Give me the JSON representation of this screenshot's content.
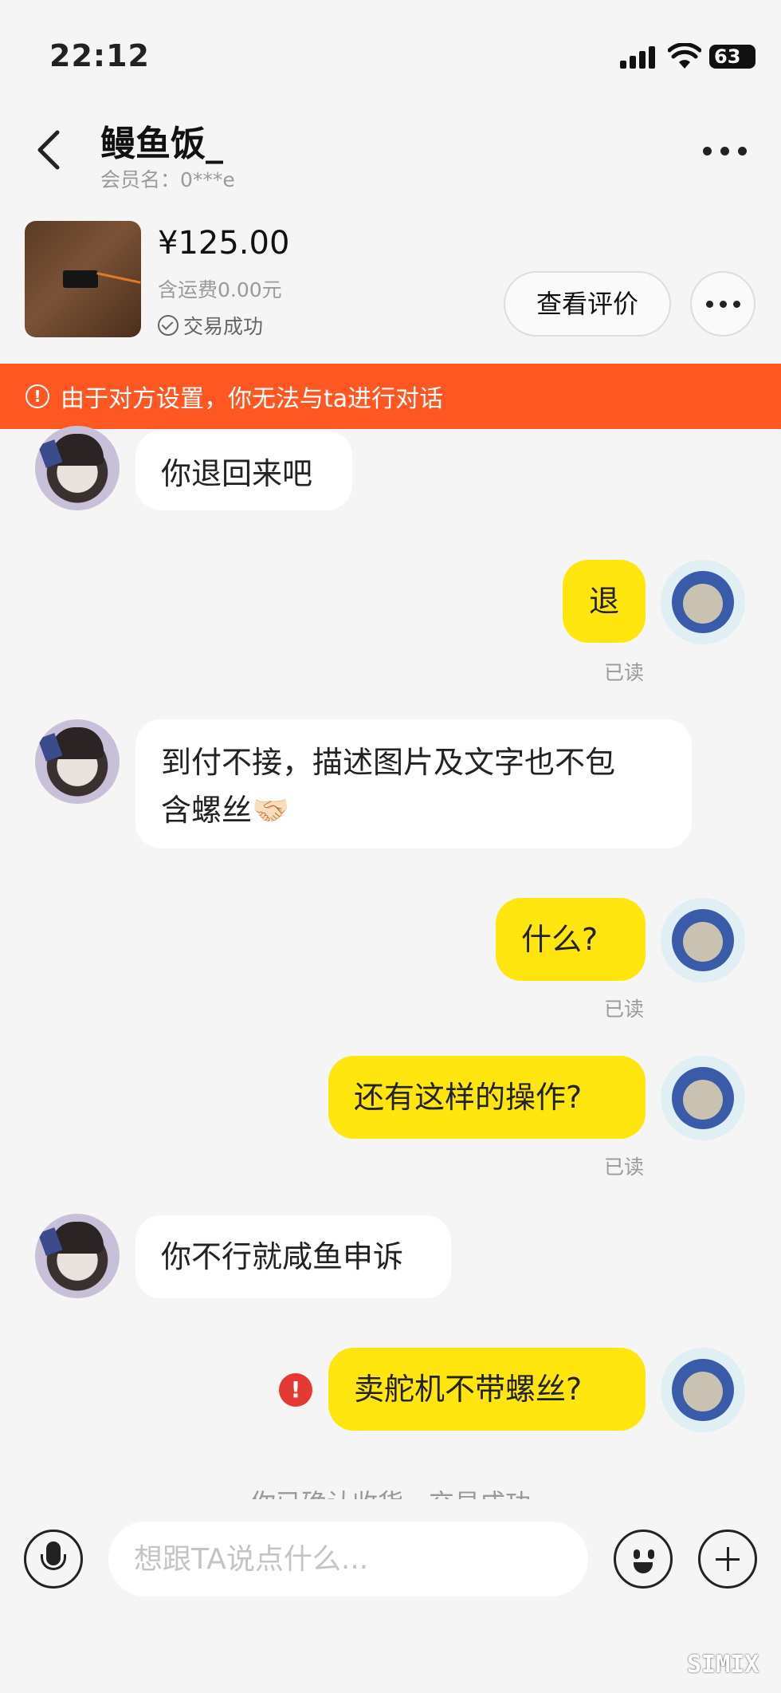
{
  "status_bar": {
    "time": "22:12",
    "battery": "63"
  },
  "header": {
    "title": "鳗鱼饭_",
    "subtitle": "会员名：0***e"
  },
  "product": {
    "price": "¥125.00",
    "shipping": "含运费0.00元",
    "status": "交易成功",
    "review_button": "查看评价"
  },
  "banner": {
    "text": "由于对方设置，你无法与ta进行对话"
  },
  "messages": [
    {
      "from": "other",
      "text": "你退回来吧"
    },
    {
      "from": "me",
      "text": "退",
      "status": "已读"
    },
    {
      "from": "other",
      "line1": "到付不接，描述图片及文字也不包",
      "line2": "含螺丝🤝🏻"
    },
    {
      "from": "me",
      "text": "什么?",
      "status": "已读"
    },
    {
      "from": "me",
      "text": "还有这样的操作?",
      "status": "已读"
    },
    {
      "from": "other",
      "text": "你不行就咸鱼申诉"
    },
    {
      "from": "me",
      "text": "卖舵机不带螺丝?",
      "status": "failed"
    }
  ],
  "system_message": "你已确认收货，交易成功",
  "input": {
    "placeholder": "想跟TA说点什么..."
  },
  "watermark": "SIMIX"
}
